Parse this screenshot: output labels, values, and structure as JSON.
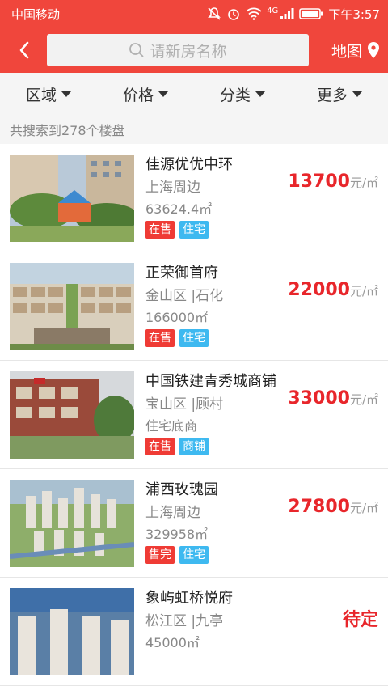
{
  "status": {
    "carrier": "中国移动",
    "time": "下午3:57",
    "network": "4G"
  },
  "topbar": {
    "search_placeholder": "请新房名称",
    "map_label": "地图"
  },
  "filters": [
    {
      "label": "区域"
    },
    {
      "label": "价格"
    },
    {
      "label": "分类"
    },
    {
      "label": "更多"
    }
  ],
  "result_count": "共搜索到278个楼盘",
  "listings": [
    {
      "name": "佳源优优中环",
      "area": "上海周边",
      "size": "63624.4㎡",
      "price": "13700",
      "unit": "元/㎡",
      "tags": [
        {
          "text": "在售",
          "color": "red"
        },
        {
          "text": "住宅",
          "color": "blue"
        }
      ]
    },
    {
      "name": "正荣御首府",
      "area": "金山区 |石化",
      "size": "166000㎡",
      "price": "22000",
      "unit": "元/㎡",
      "tags": [
        {
          "text": "在售",
          "color": "red"
        },
        {
          "text": "住宅",
          "color": "blue"
        }
      ]
    },
    {
      "name": "中国铁建青秀城商铺",
      "area": "宝山区 |顾村",
      "size": "住宅底商",
      "price": "33000",
      "unit": "元/㎡",
      "tags": [
        {
          "text": "在售",
          "color": "red"
        },
        {
          "text": "商铺",
          "color": "blue"
        }
      ]
    },
    {
      "name": "浦西玫瑰园",
      "area": "上海周边",
      "size": "329958㎡",
      "price": "27800",
      "unit": "元/㎡",
      "tags": [
        {
          "text": "售完",
          "color": "red"
        },
        {
          "text": "住宅",
          "color": "blue"
        }
      ]
    },
    {
      "name": "象屿虹桥悦府",
      "area": "松江区 |九亭",
      "size": "45000㎡",
      "price": "待定",
      "unit": "",
      "tags": []
    }
  ],
  "colors": {
    "brand": "#f0463c",
    "price": "#e8262b",
    "tag_red": "#ef3b35",
    "tag_blue": "#3eb9f0"
  }
}
